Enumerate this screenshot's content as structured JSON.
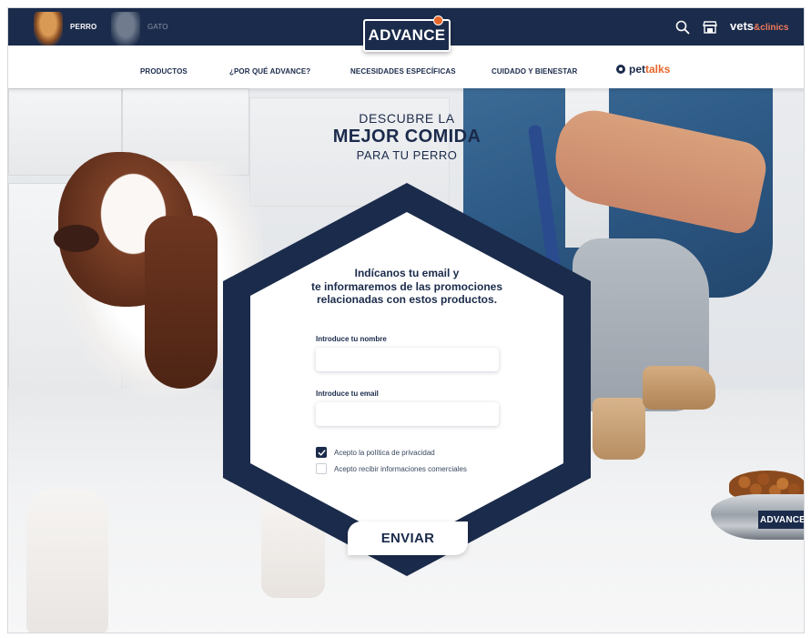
{
  "header": {
    "pet_tabs": [
      {
        "label": "PERRO",
        "active": true
      },
      {
        "label": "GATO",
        "active": false
      }
    ],
    "logo": "ADVANCE",
    "vets_logo": {
      "part1": "vets",
      "part2": "&clinics"
    },
    "icons": {
      "search": "search-icon",
      "store": "store-icon"
    }
  },
  "nav": {
    "items": [
      "PRODUCTOS",
      "¿POR QUÉ ADVANCE?",
      "NECESIDADES ESPECÍFICAS",
      "CUIDADO Y BIENESTAR"
    ],
    "pettalks": {
      "part1": "pet",
      "part2": "talks"
    }
  },
  "hero": {
    "line1": "DESCUBRE LA",
    "line2": "MEJOR COMIDA",
    "line3": "PARA TU PERRO",
    "bowl_label": "ADVANCE"
  },
  "form": {
    "title_line1": "Indícanos tu email y",
    "title_line2": "te informaremos de las promociones",
    "title_line3": "relacionadas con estos productos.",
    "name_label": "Introduce tu nombre",
    "name_value": "",
    "email_label": "Introduce tu email",
    "email_value": "",
    "checkbox_privacy": {
      "label": "Acepto la política de privacidad",
      "checked": true
    },
    "checkbox_marketing": {
      "label": "Acepto recibir informaciones comerciales",
      "checked": false
    },
    "submit_label": "ENVIAR"
  },
  "colors": {
    "navy": "#1b2b4b",
    "accent_orange": "#e8662a",
    "clinics_coral": "#f07a5a",
    "white": "#ffffff"
  }
}
